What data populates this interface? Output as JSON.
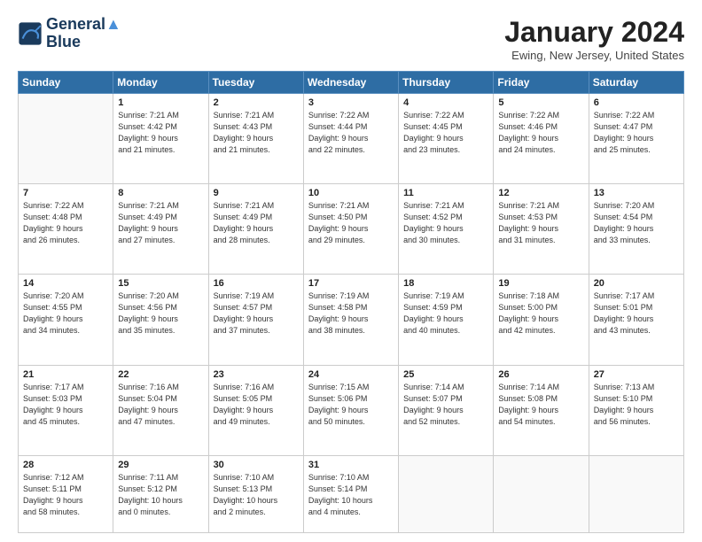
{
  "header": {
    "logo_line1": "General",
    "logo_line2": "Blue",
    "month": "January 2024",
    "location": "Ewing, New Jersey, United States"
  },
  "weekdays": [
    "Sunday",
    "Monday",
    "Tuesday",
    "Wednesday",
    "Thursday",
    "Friday",
    "Saturday"
  ],
  "weeks": [
    [
      {
        "day": "",
        "info": ""
      },
      {
        "day": "1",
        "info": "Sunrise: 7:21 AM\nSunset: 4:42 PM\nDaylight: 9 hours\nand 21 minutes."
      },
      {
        "day": "2",
        "info": "Sunrise: 7:21 AM\nSunset: 4:43 PM\nDaylight: 9 hours\nand 21 minutes."
      },
      {
        "day": "3",
        "info": "Sunrise: 7:22 AM\nSunset: 4:44 PM\nDaylight: 9 hours\nand 22 minutes."
      },
      {
        "day": "4",
        "info": "Sunrise: 7:22 AM\nSunset: 4:45 PM\nDaylight: 9 hours\nand 23 minutes."
      },
      {
        "day": "5",
        "info": "Sunrise: 7:22 AM\nSunset: 4:46 PM\nDaylight: 9 hours\nand 24 minutes."
      },
      {
        "day": "6",
        "info": "Sunrise: 7:22 AM\nSunset: 4:47 PM\nDaylight: 9 hours\nand 25 minutes."
      }
    ],
    [
      {
        "day": "7",
        "info": "Sunrise: 7:22 AM\nSunset: 4:48 PM\nDaylight: 9 hours\nand 26 minutes."
      },
      {
        "day": "8",
        "info": "Sunrise: 7:21 AM\nSunset: 4:49 PM\nDaylight: 9 hours\nand 27 minutes."
      },
      {
        "day": "9",
        "info": "Sunrise: 7:21 AM\nSunset: 4:49 PM\nDaylight: 9 hours\nand 28 minutes."
      },
      {
        "day": "10",
        "info": "Sunrise: 7:21 AM\nSunset: 4:50 PM\nDaylight: 9 hours\nand 29 minutes."
      },
      {
        "day": "11",
        "info": "Sunrise: 7:21 AM\nSunset: 4:52 PM\nDaylight: 9 hours\nand 30 minutes."
      },
      {
        "day": "12",
        "info": "Sunrise: 7:21 AM\nSunset: 4:53 PM\nDaylight: 9 hours\nand 31 minutes."
      },
      {
        "day": "13",
        "info": "Sunrise: 7:20 AM\nSunset: 4:54 PM\nDaylight: 9 hours\nand 33 minutes."
      }
    ],
    [
      {
        "day": "14",
        "info": "Sunrise: 7:20 AM\nSunset: 4:55 PM\nDaylight: 9 hours\nand 34 minutes."
      },
      {
        "day": "15",
        "info": "Sunrise: 7:20 AM\nSunset: 4:56 PM\nDaylight: 9 hours\nand 35 minutes."
      },
      {
        "day": "16",
        "info": "Sunrise: 7:19 AM\nSunset: 4:57 PM\nDaylight: 9 hours\nand 37 minutes."
      },
      {
        "day": "17",
        "info": "Sunrise: 7:19 AM\nSunset: 4:58 PM\nDaylight: 9 hours\nand 38 minutes."
      },
      {
        "day": "18",
        "info": "Sunrise: 7:19 AM\nSunset: 4:59 PM\nDaylight: 9 hours\nand 40 minutes."
      },
      {
        "day": "19",
        "info": "Sunrise: 7:18 AM\nSunset: 5:00 PM\nDaylight: 9 hours\nand 42 minutes."
      },
      {
        "day": "20",
        "info": "Sunrise: 7:17 AM\nSunset: 5:01 PM\nDaylight: 9 hours\nand 43 minutes."
      }
    ],
    [
      {
        "day": "21",
        "info": "Sunrise: 7:17 AM\nSunset: 5:03 PM\nDaylight: 9 hours\nand 45 minutes."
      },
      {
        "day": "22",
        "info": "Sunrise: 7:16 AM\nSunset: 5:04 PM\nDaylight: 9 hours\nand 47 minutes."
      },
      {
        "day": "23",
        "info": "Sunrise: 7:16 AM\nSunset: 5:05 PM\nDaylight: 9 hours\nand 49 minutes."
      },
      {
        "day": "24",
        "info": "Sunrise: 7:15 AM\nSunset: 5:06 PM\nDaylight: 9 hours\nand 50 minutes."
      },
      {
        "day": "25",
        "info": "Sunrise: 7:14 AM\nSunset: 5:07 PM\nDaylight: 9 hours\nand 52 minutes."
      },
      {
        "day": "26",
        "info": "Sunrise: 7:14 AM\nSunset: 5:08 PM\nDaylight: 9 hours\nand 54 minutes."
      },
      {
        "day": "27",
        "info": "Sunrise: 7:13 AM\nSunset: 5:10 PM\nDaylight: 9 hours\nand 56 minutes."
      }
    ],
    [
      {
        "day": "28",
        "info": "Sunrise: 7:12 AM\nSunset: 5:11 PM\nDaylight: 9 hours\nand 58 minutes."
      },
      {
        "day": "29",
        "info": "Sunrise: 7:11 AM\nSunset: 5:12 PM\nDaylight: 10 hours\nand 0 minutes."
      },
      {
        "day": "30",
        "info": "Sunrise: 7:10 AM\nSunset: 5:13 PM\nDaylight: 10 hours\nand 2 minutes."
      },
      {
        "day": "31",
        "info": "Sunrise: 7:10 AM\nSunset: 5:14 PM\nDaylight: 10 hours\nand 4 minutes."
      },
      {
        "day": "",
        "info": ""
      },
      {
        "day": "",
        "info": ""
      },
      {
        "day": "",
        "info": ""
      }
    ]
  ]
}
